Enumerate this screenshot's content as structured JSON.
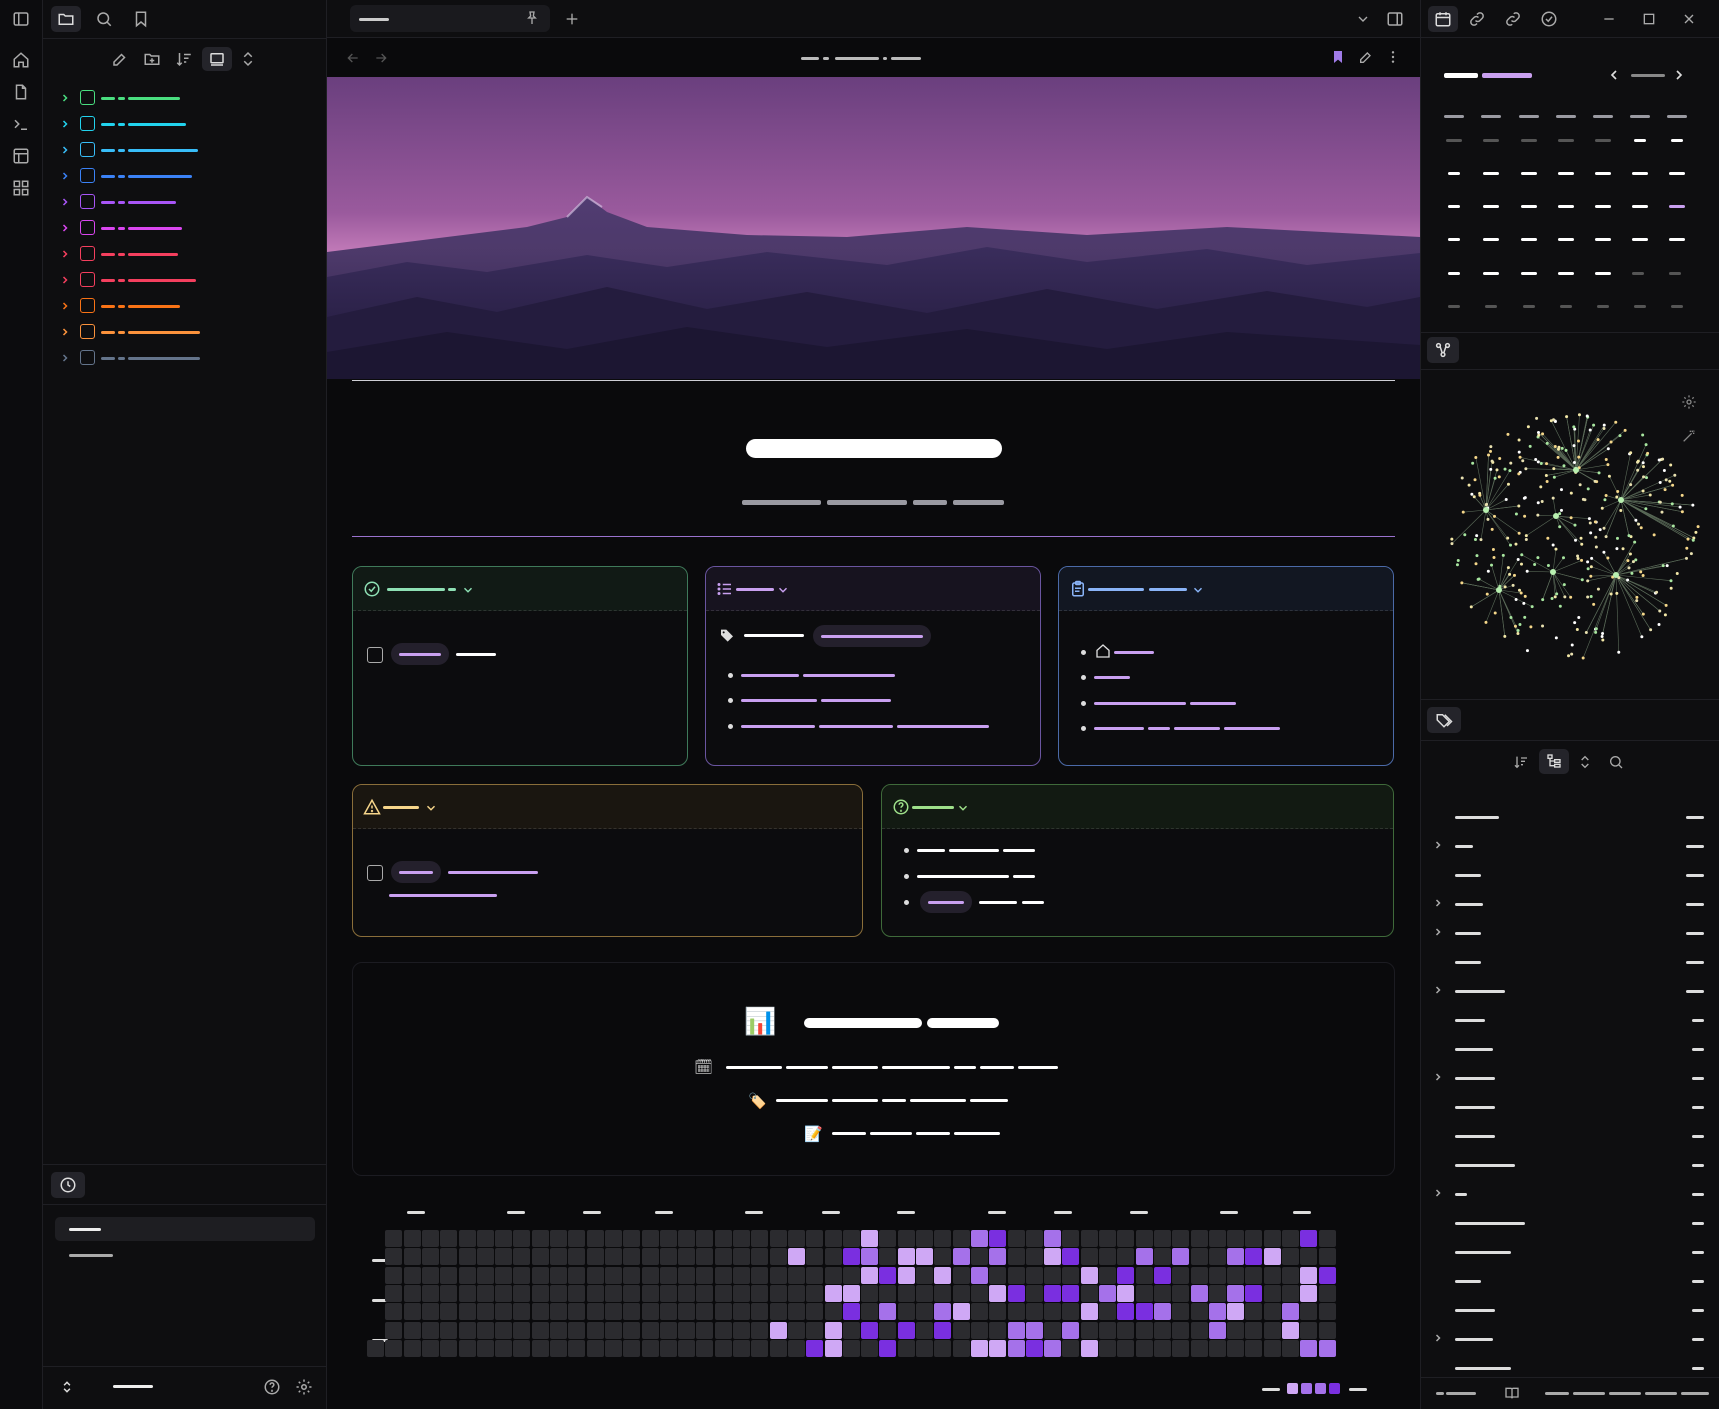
{
  "colors": {
    "accent": "#a07be8",
    "bg": "#0a0a0c",
    "panel": "#0e0e10",
    "hm_empty": "#2b2b2f",
    "hm_l1": "#cfa8f5",
    "hm_l2": "#a571ea",
    "hm_l3": "#7a2fe0"
  },
  "ribbon": {
    "icons": [
      "home-icon",
      "file-plus-icon",
      "terminal-icon",
      "layout-icon",
      "grid-icon",
      "sidebar-toggle-icon"
    ]
  },
  "explorer": {
    "toolbar_icons": [
      "new-note-icon",
      "new-folder-icon",
      "sort-icon",
      "collapse-icon",
      "expand-icon"
    ],
    "folder_colors": [
      "#4ade80",
      "#22d3ee",
      "#38bdf8",
      "#3b82f6",
      "#a855f7",
      "#d946ef",
      "#f43f5e",
      "#f43f5e",
      "#f97316",
      "#fb923c",
      "#64748b"
    ],
    "folder_icons": [
      "git-branch-icon",
      "lock-icon",
      "database-icon",
      "workflow-icon",
      "briefcase-icon",
      "graduation-cap-icon",
      "calendar-check-icon",
      "archive-icon",
      "book-icon",
      "shapes-icon",
      "layout-template-icon"
    ]
  },
  "tabs": {
    "active_icon": "pin-icon"
  },
  "heatmap": {
    "weeks": 53,
    "days": 7
  }
}
